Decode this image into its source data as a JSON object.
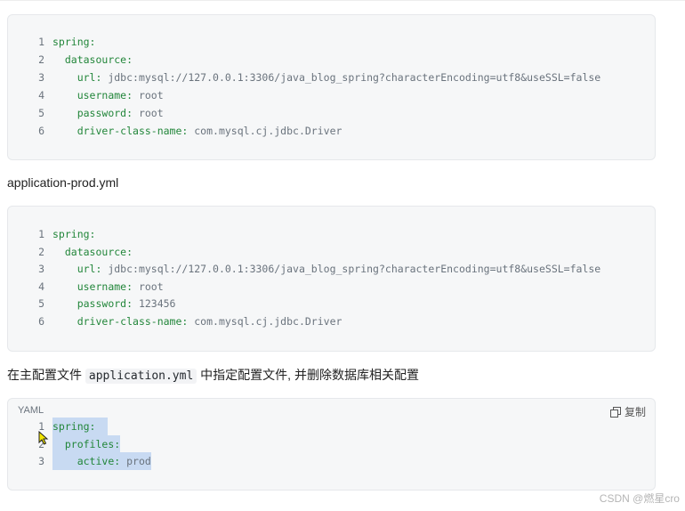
{
  "blocks": [
    {
      "lines": [
        {
          "n": "1",
          "indent": "",
          "key": "spring:",
          "value": ""
        },
        {
          "n": "2",
          "indent": "  ",
          "key": "datasource:",
          "value": ""
        },
        {
          "n": "3",
          "indent": "    ",
          "key": "url:",
          "value": " jdbc:mysql://127.0.0.1:3306/java_blog_spring?characterEncoding=utf8&useSSL=false"
        },
        {
          "n": "4",
          "indent": "    ",
          "key": "username:",
          "value": " root"
        },
        {
          "n": "5",
          "indent": "    ",
          "key": "password:",
          "value": " root"
        },
        {
          "n": "6",
          "indent": "    ",
          "key": "driver-class-name:",
          "value": " com.mysql.cj.jdbc.Driver"
        }
      ]
    },
    {
      "lines": [
        {
          "n": "1",
          "indent": "",
          "key": "spring:",
          "value": ""
        },
        {
          "n": "2",
          "indent": "  ",
          "key": "datasource:",
          "value": ""
        },
        {
          "n": "3",
          "indent": "    ",
          "key": "url:",
          "value": " jdbc:mysql://127.0.0.1:3306/java_blog_spring?characterEncoding=utf8&useSSL=false"
        },
        {
          "n": "4",
          "indent": "    ",
          "key": "username:",
          "value": " root"
        },
        {
          "n": "5",
          "indent": "    ",
          "key": "password:",
          "value": " 123456"
        },
        {
          "n": "6",
          "indent": "    ",
          "key": "driver-class-name:",
          "value": " com.mysql.cj.jdbc.Driver"
        }
      ]
    },
    {
      "lang": "YAML",
      "copy_label": "复制",
      "lines": [
        {
          "n": "1",
          "indent": "",
          "key": "spring:",
          "value": ""
        },
        {
          "n": "2",
          "indent": "  ",
          "key": "profiles:",
          "value": ""
        },
        {
          "n": "3",
          "indent": "    ",
          "key": "active:",
          "value": " prod"
        }
      ]
    }
  ],
  "filename_heading": "application-prod.yml",
  "instruction": {
    "before": "在主配置文件 ",
    "code": "application.yml",
    "after": " 中指定配置文件, 并删除数据库相关配置"
  },
  "watermark": "CSDN @燃星cro",
  "colors": {
    "key": "#22863a",
    "value": "#6a737d",
    "selection": "#c8daf2"
  },
  "icons": {
    "copy": "copy-icon",
    "cursor": "mouse-cursor-icon"
  }
}
